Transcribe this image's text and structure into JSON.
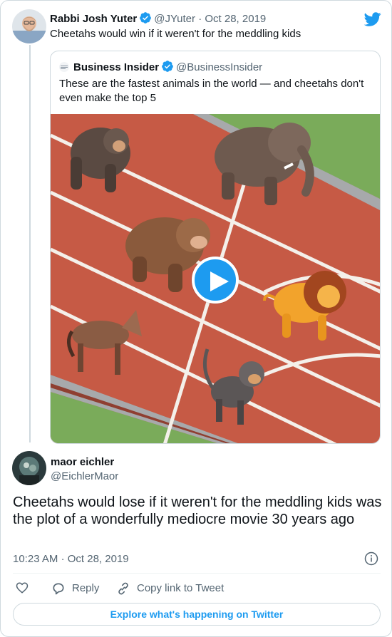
{
  "tweet1": {
    "author_name": "Rabbi Josh Yuter",
    "handle": "@JYuter",
    "separator": "·",
    "date": "Oct 28, 2019",
    "text": "Cheetahs would win if it weren't for the meddling kids"
  },
  "quoted": {
    "author_name": "Business Insider",
    "handle": "@BusinessInsider",
    "text": "These are the fastest animals in the world — and cheetahs don't even make the top 5",
    "media": {
      "kind": "video",
      "play_icon": "play-icon",
      "animals": [
        "gorilla",
        "elephant",
        "bear",
        "lion",
        "horse",
        "monkey"
      ]
    }
  },
  "reply": {
    "author_name": "maor eichler",
    "handle": "@EichlerMaor",
    "text": "Cheetahs would lose if it weren't for the meddling kids was the plot of a wonderfully mediocre movie 30 years ago",
    "time": "10:23 AM",
    "separator": "·",
    "date": "Oct 28, 2019"
  },
  "actions": {
    "like_icon": "heart-icon",
    "reply_label": "Reply",
    "copy_label": "Copy link to Tweet"
  },
  "footer": {
    "explore_label": "Explore what's happening on Twitter"
  },
  "colors": {
    "brand": "#1d9bf0",
    "text": "#0f1419",
    "muted": "#536471",
    "border": "#cfd9de",
    "track": "#c65a45",
    "grass": "#7aab5a"
  }
}
